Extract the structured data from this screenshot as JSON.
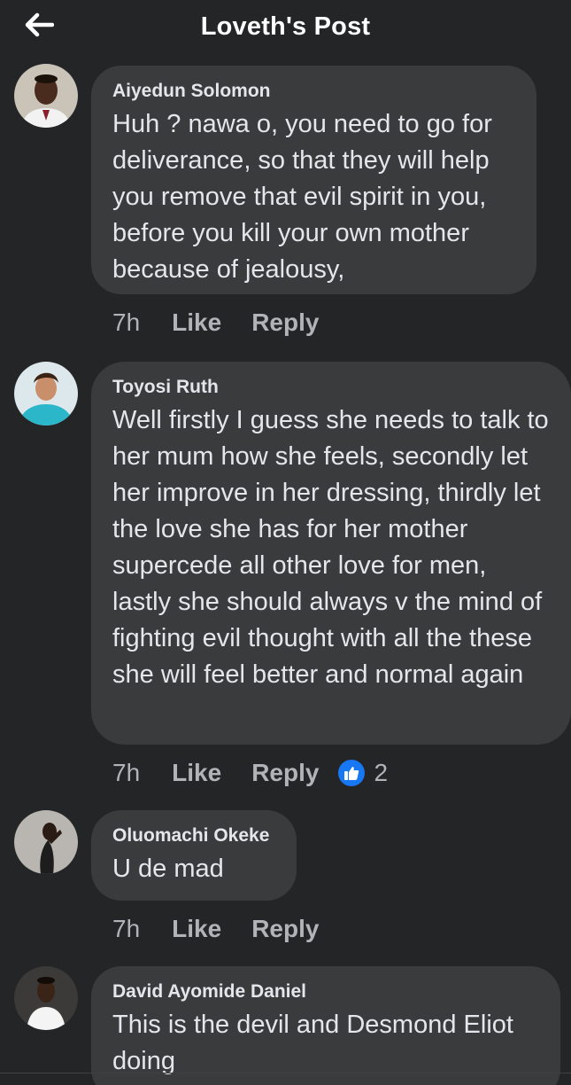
{
  "header": {
    "title": "Loveth's Post",
    "back_icon": "arrow-left-icon"
  },
  "comments": [
    {
      "author": "Aiyedun Solomon",
      "text": "Huh ? nawa o, you need to go for deliverance, so that they will help you remove that evil spirit in you, before you kill your own mother because of jealousy,",
      "time": "7h",
      "like_label": "Like",
      "reply_label": "Reply"
    },
    {
      "author": "Toyosi Ruth",
      "text": "Well firstly I guess she needs to talk to her mum how she feels, secondly let her improve in her dressing, thirdly let the love she has for her mother supercede all other love for men, lastly she should always v the mind of fighting evil thought with all the these she will feel better and normal again",
      "time": "7h",
      "like_label": "Like",
      "reply_label": "Reply",
      "reaction_count": "2"
    },
    {
      "author": "Oluomachi Okeke",
      "text": "U de mad",
      "time": "7h",
      "like_label": "Like",
      "reply_label": "Reply"
    },
    {
      "author": "David Ayomide Daniel",
      "text": "This is the devil and Desmond Eliot doing"
    }
  ]
}
